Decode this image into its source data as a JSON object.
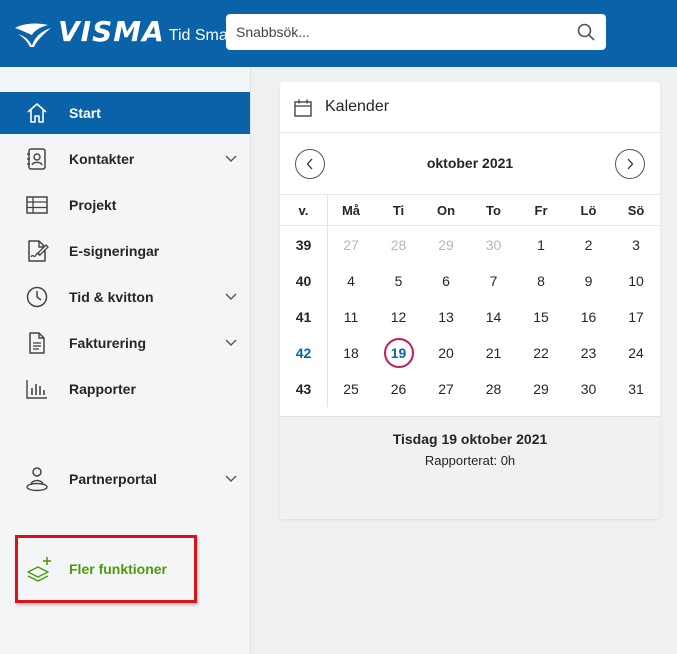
{
  "header": {
    "logo_text": "VISMA",
    "product_name": "Tid Smart",
    "search_placeholder": "Snabbsök..."
  },
  "colors": {
    "brand_blue": "#0a62a8",
    "highlight_red": "#d7141a",
    "green": "#4d9a0f",
    "today_ring": "#c8175d"
  },
  "sidebar": {
    "items": [
      {
        "label": "Start",
        "icon": "home-icon",
        "active": true,
        "expandable": false
      },
      {
        "label": "Kontakter",
        "icon": "contacts-icon",
        "active": false,
        "expandable": true
      },
      {
        "label": "Projekt",
        "icon": "project-table-icon",
        "active": false,
        "expandable": false
      },
      {
        "label": "E-signeringar",
        "icon": "e-sign-icon",
        "active": false,
        "expandable": false
      },
      {
        "label": "Tid & kvitton",
        "icon": "clock-icon",
        "active": false,
        "expandable": true
      },
      {
        "label": "Fakturering",
        "icon": "invoice-icon",
        "active": false,
        "expandable": true
      },
      {
        "label": "Rapporter",
        "icon": "bar-chart-icon",
        "active": false,
        "expandable": false
      },
      {
        "label": "Partnerportal",
        "icon": "partner-icon",
        "active": false,
        "expandable": true
      }
    ],
    "more": {
      "label": "Fler funktioner",
      "icon": "layers-plus-icon"
    }
  },
  "calendar": {
    "title": "Kalender",
    "month_label": "oktober 2021",
    "week_header": "v.",
    "weekdays": [
      "Må",
      "Ti",
      "On",
      "To",
      "Fr",
      "Lö",
      "Sö"
    ],
    "weeks": [
      {
        "number": "39",
        "current": false,
        "days": [
          {
            "d": "27",
            "muted": true
          },
          {
            "d": "28",
            "muted": true
          },
          {
            "d": "29",
            "muted": true
          },
          {
            "d": "30",
            "muted": true
          },
          {
            "d": "1"
          },
          {
            "d": "2"
          },
          {
            "d": "3"
          }
        ]
      },
      {
        "number": "40",
        "current": false,
        "days": [
          {
            "d": "4"
          },
          {
            "d": "5"
          },
          {
            "d": "6"
          },
          {
            "d": "7"
          },
          {
            "d": "8"
          },
          {
            "d": "9"
          },
          {
            "d": "10"
          }
        ]
      },
      {
        "number": "41",
        "current": false,
        "days": [
          {
            "d": "11"
          },
          {
            "d": "12"
          },
          {
            "d": "13"
          },
          {
            "d": "14"
          },
          {
            "d": "15"
          },
          {
            "d": "16"
          },
          {
            "d": "17"
          }
        ]
      },
      {
        "number": "42",
        "current": true,
        "days": [
          {
            "d": "18"
          },
          {
            "d": "19",
            "today": true
          },
          {
            "d": "20"
          },
          {
            "d": "21"
          },
          {
            "d": "22"
          },
          {
            "d": "23"
          },
          {
            "d": "24"
          }
        ]
      },
      {
        "number": "43",
        "current": false,
        "days": [
          {
            "d": "25"
          },
          {
            "d": "26"
          },
          {
            "d": "27"
          },
          {
            "d": "28"
          },
          {
            "d": "29"
          },
          {
            "d": "30"
          },
          {
            "d": "31"
          }
        ]
      }
    ],
    "selected_date": "Tisdag 19 oktober 2021",
    "reported": "Rapporterat: 0h"
  }
}
